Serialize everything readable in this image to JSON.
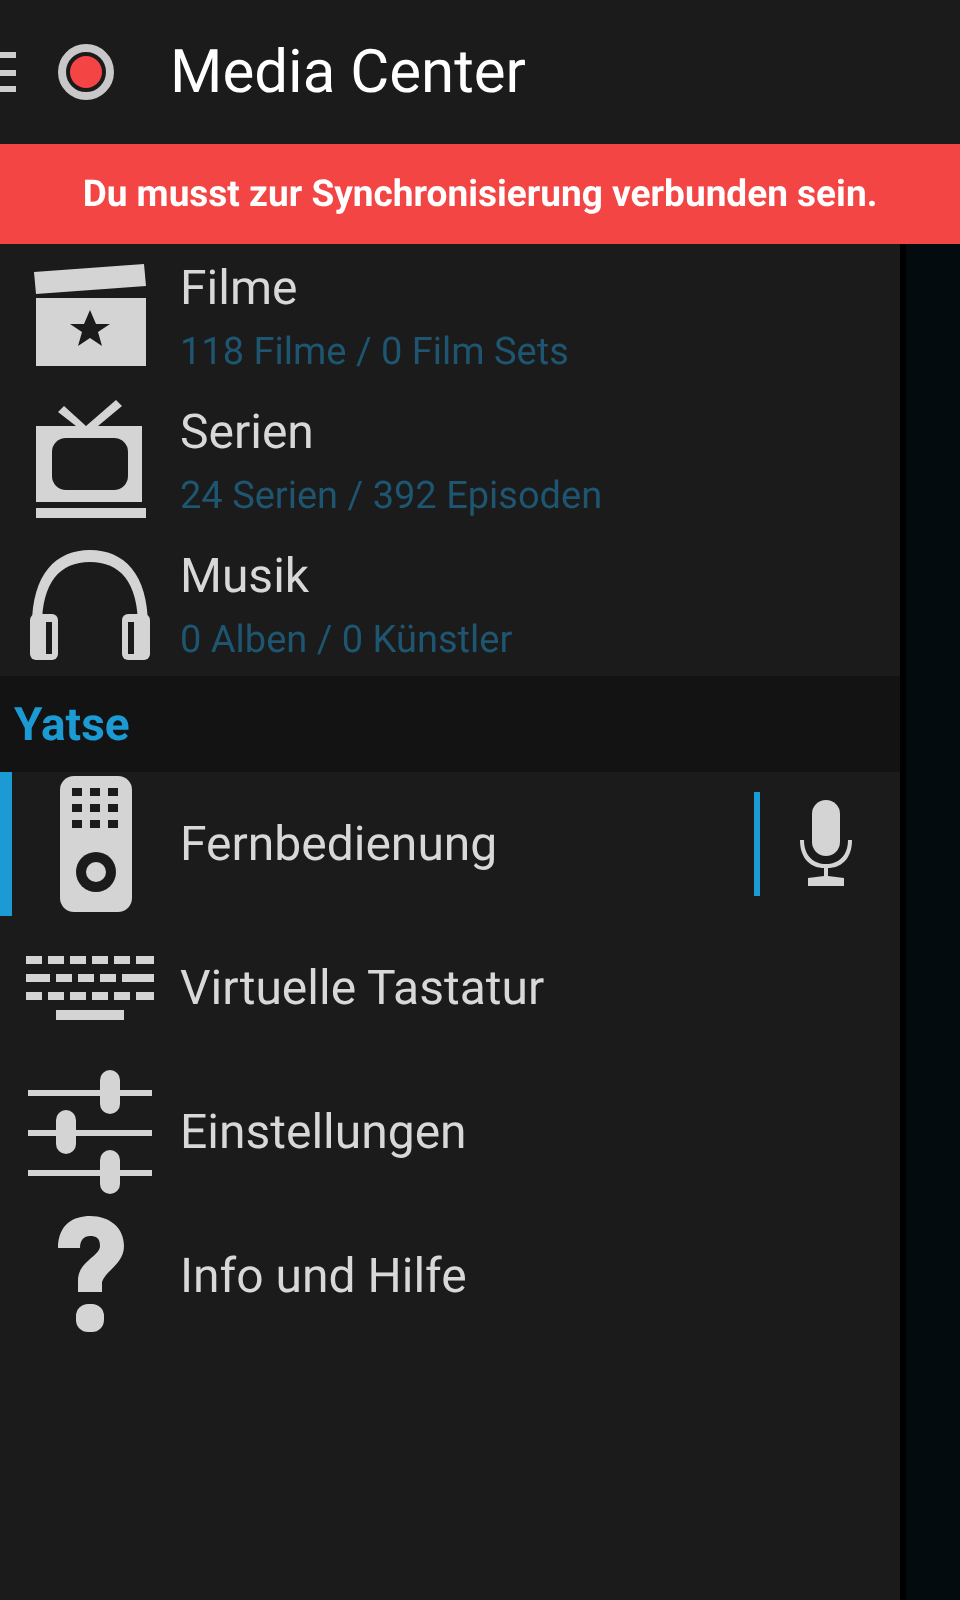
{
  "app_bar": {
    "title": "Media Center"
  },
  "banner": {
    "text": "Du musst zur Synchronisierung verbunden sein."
  },
  "library": [
    {
      "title": "Filme",
      "subtitle": "118 Filme / 0 Film Sets",
      "selected": false
    },
    {
      "title": "Serien",
      "subtitle": "24 Serien / 392 Episoden",
      "selected": false
    },
    {
      "title": "Musik",
      "subtitle": "0 Alben / 0 Künstler",
      "selected": false
    }
  ],
  "section": {
    "title": "Yatse"
  },
  "nav": [
    {
      "label": "Fernbedienung",
      "selected": true
    },
    {
      "label": "Virtuelle Tastatur",
      "selected": false
    },
    {
      "label": "Einstellungen",
      "selected": false
    },
    {
      "label": "Info und Hilfe",
      "selected": false
    }
  ]
}
